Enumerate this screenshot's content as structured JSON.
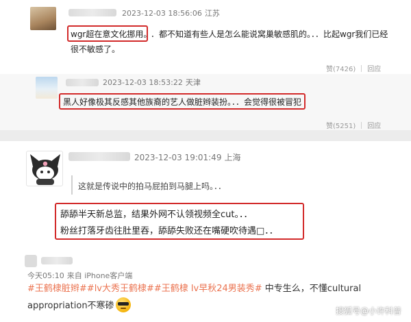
{
  "comments": [
    {
      "meta": {
        "timestamp": "2023-12-03 18:56:06",
        "location": "江苏"
      },
      "text_highlight": "wgr超在意文化挪用。",
      "text_rest": "．都不知道有些人是怎么能说窝巢敏感肌的。．．比起wgr我们已经",
      "text_line2": "很不敏感了。",
      "likes": "赞(7426)",
      "reply": "回应"
    },
    {
      "meta": {
        "timestamp": "2023-12-03 18:53:22",
        "location": "天津"
      },
      "text": "黑人好像极其反感其他族裔的艺人做脏辫装扮。．．会觉得很被冒犯",
      "likes": "赞(5251)",
      "reply": "回应"
    },
    {
      "meta": {
        "timestamp": "2023-12-03 19:01:49",
        "location": "上海"
      },
      "quote": "这就是传说中的拍马屁拍到马腿上吗。．．",
      "line1": "舔舔半天新总监，结果外网不认领视频全cut。．．",
      "line2": "粉丝打落牙齿往肚里吞，舔舔失败还在嘴硬吹待遇□．．"
    }
  ],
  "post": {
    "time": "今天05:10",
    "source": "来自 iPhone客户端",
    "tags": [
      "#王鹤棣脏辫#",
      "#lv大秀",
      "王鹤棣#",
      "#王鹤棣 lv早秋24男装秀#"
    ],
    "text_after_tags": " 中专生么，不懂cultural",
    "text_line2": "appropriation不寒碜"
  },
  "watermark": "搜狐号@小许科普"
}
